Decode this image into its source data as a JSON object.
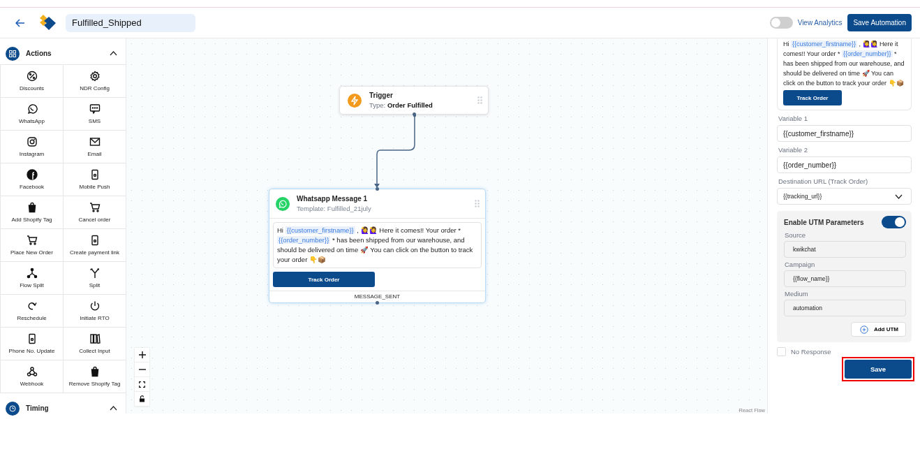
{
  "header": {
    "title": "Fulfilled_Shipped",
    "analytics": {
      "label": "View Analytics",
      "on": false
    },
    "save_button": "Save Automation"
  },
  "sidebar": {
    "sections": [
      {
        "title": "Actions",
        "expanded": true,
        "items": [
          {
            "label": "Discounts"
          },
          {
            "label": "NDR Config"
          },
          {
            "label": "WhatsApp"
          },
          {
            "label": "SMS"
          },
          {
            "label": "Instagram"
          },
          {
            "label": "Email"
          },
          {
            "label": "Facebook"
          },
          {
            "label": "Mobile Push"
          },
          {
            "label": "Add Shopify Tag"
          },
          {
            "label": "Cancel order"
          },
          {
            "label": "Place New Order"
          },
          {
            "label": "Create payment link"
          },
          {
            "label": "Flow Split"
          },
          {
            "label": "Split"
          },
          {
            "label": "Reschedule"
          },
          {
            "label": "Initiate RTO"
          },
          {
            "label": "Phone No. Update"
          },
          {
            "label": "Collect Input"
          },
          {
            "label": "Webhook"
          },
          {
            "label": "Remove Shopify Tag"
          }
        ]
      },
      {
        "title": "Timing",
        "expanded": true
      }
    ]
  },
  "canvas": {
    "trigger": {
      "title": "Trigger",
      "type_label": "Type:",
      "type_value": "Order Fulfilled"
    },
    "message_node": {
      "title": "Whatsapp Message 1",
      "template": "Template: Fulfilled_21july",
      "message": [
        {
          "kind": "text",
          "text": "Hi "
        },
        {
          "kind": "variable",
          "text": "{{customer_firstname}}"
        },
        {
          "kind": "text",
          "text": " , 🙋‍♀️🙋‍♀️ Here it comes!! Your order * "
        },
        {
          "kind": "variable",
          "text": "{{order_number}}"
        },
        {
          "kind": "text",
          "text": " * has been shipped from our warehouse, and should be delivered on time 🚀 You can click on the button to track your order 👇📦"
        }
      ],
      "button": "Track Order",
      "output": "MESSAGE_SENT"
    },
    "attribution": "React Flow"
  },
  "panel": {
    "preview": {
      "message": [
        {
          "kind": "text",
          "text": "Hi "
        },
        {
          "kind": "variable",
          "text": "{{customer_firstname}}"
        },
        {
          "kind": "text",
          "text": " , 🙋‍♀️🙋‍♀️ Here it comes!! Your order * "
        },
        {
          "kind": "variable",
          "text": "{{order_number}}"
        },
        {
          "kind": "text",
          "text": " * has been shipped from our warehouse, and should be delivered on time 🚀 You can click on the button to track your order 👇📦"
        }
      ],
      "button": "Track Order"
    },
    "variables": [
      {
        "label": "Variable 1",
        "value": "{{customer_firstname}}"
      },
      {
        "label": "Variable 2",
        "value": "{{order_number}}"
      }
    ],
    "destination": {
      "label": "Destination URL (Track Order)",
      "value": "{{tracking_url}}"
    },
    "utm": {
      "label": "Enable UTM Parameters",
      "on": true,
      "fields": [
        {
          "label": "Source",
          "value": "kwikchat"
        },
        {
          "label": "Campaign",
          "value": "{{flow_name}}"
        },
        {
          "label": "Medium",
          "value": "automation"
        }
      ],
      "add_button": "Add UTM"
    },
    "no_response": {
      "label": "No Response",
      "checked": false
    },
    "save_button": "Save",
    "save_highlighted": true
  }
}
